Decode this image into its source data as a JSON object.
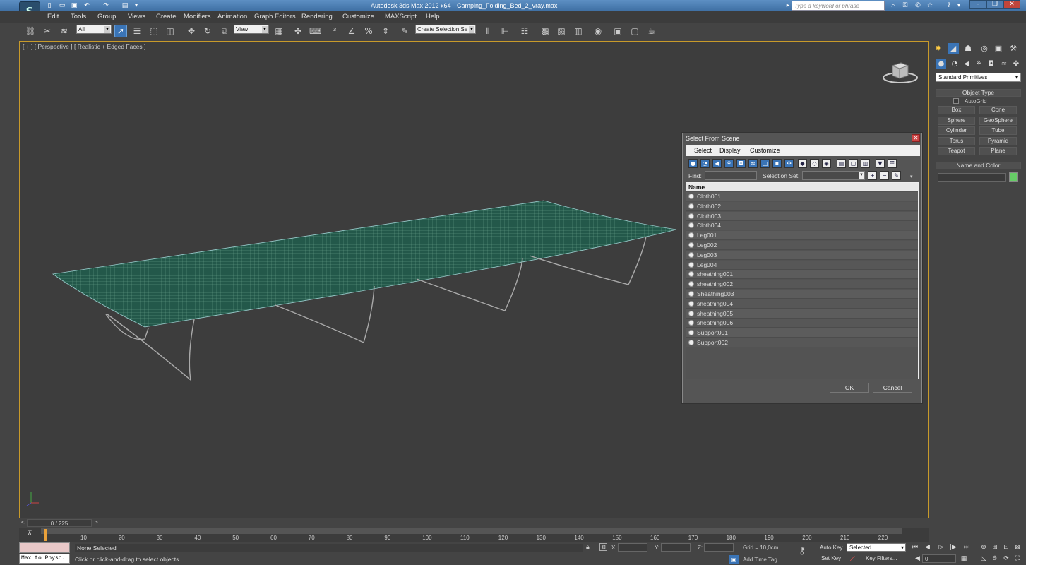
{
  "titlebar": {
    "app": "Autodesk 3ds Max  2012 x64",
    "file": "Camping_Folding_Bed_2_vray.max",
    "search_placeholder": "Type a keyword or phrase"
  },
  "menu": [
    "Edit",
    "Tools",
    "Group",
    "Views",
    "Create",
    "Modifiers",
    "Animation",
    "Graph Editors",
    "Rendering",
    "Customize",
    "MAXScript",
    "Help"
  ],
  "toolbar": {
    "filter": "All",
    "refcoord": "View",
    "selset": "Create Selection Se"
  },
  "viewport": {
    "label": "[ + ] [ Perspective ] [ Realistic + Edged Faces ]"
  },
  "cmdpanel": {
    "category": "Standard Primitives",
    "object_type": "Object Type",
    "autogrid": "AutoGrid",
    "buttons": [
      "Box",
      "Cone",
      "Sphere",
      "GeoSphere",
      "Cylinder",
      "Tube",
      "Torus",
      "Pyramid",
      "Teapot",
      "Plane"
    ],
    "name_color": "Name and Color"
  },
  "dialog": {
    "title": "Select From Scene",
    "menu": [
      "Select",
      "Display",
      "Customize"
    ],
    "find_label": "Find:",
    "selset_label": "Selection Set:",
    "col_name": "Name",
    "items": [
      "Cloth001",
      "Cloth002",
      "Cloth003",
      "Cloth004",
      "Leg001",
      "Leg002",
      "Leg003",
      "Leg004",
      "sheathing001",
      "sheathing002",
      "Sheathing003",
      "sheathing004",
      "sheathing005",
      "sheathing006",
      "Support001",
      "Support002"
    ],
    "ok": "OK",
    "cancel": "Cancel"
  },
  "timeline": {
    "frame": "0 / 225",
    "ticks": [
      "10",
      "20",
      "30",
      "40",
      "50",
      "60",
      "70",
      "80",
      "90",
      "100",
      "110",
      "120",
      "130",
      "140",
      "150",
      "160",
      "170",
      "180",
      "190",
      "200",
      "210",
      "220"
    ]
  },
  "status": {
    "maxscript": "Max to Physc.",
    "selection": "None Selected",
    "prompt": "Click or click-and-drag to select objects",
    "x": "X:",
    "y": "Y:",
    "z": "Z:",
    "grid": "Grid = 10,0cm",
    "add_time_tag": "Add Time Tag",
    "auto_key": "Auto Key",
    "set_key": "Set Key",
    "key_mode": "Selected",
    "key_filters": "Key Filters...",
    "frame": "0"
  }
}
